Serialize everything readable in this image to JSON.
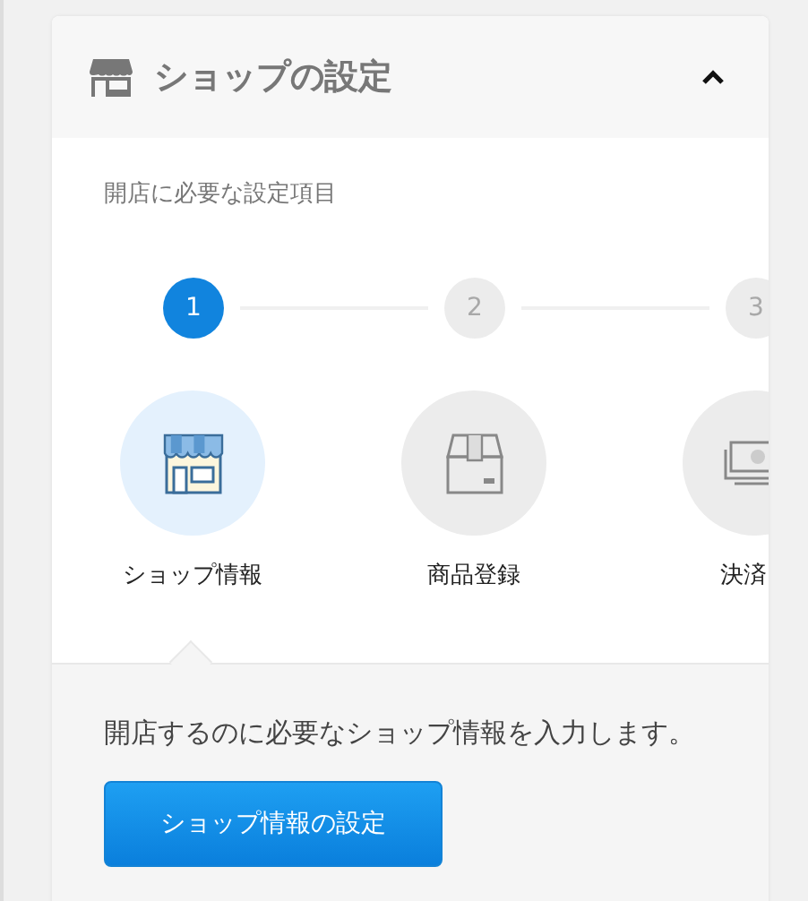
{
  "panel": {
    "title": "ショップの設定",
    "expanded": true
  },
  "subtitle": "開店に必要な設定項目",
  "steps": [
    {
      "number": "1",
      "label": "ショップ情報",
      "selected": true,
      "kind": "shop"
    },
    {
      "number": "2",
      "label": "商品登録",
      "selected": false,
      "kind": "box"
    },
    {
      "number": "3",
      "label": "決済",
      "selected": false,
      "kind": "money"
    }
  ],
  "description": "開店するのに必要なショップ情報を入力します。",
  "button": "ショップ情報の設定"
}
